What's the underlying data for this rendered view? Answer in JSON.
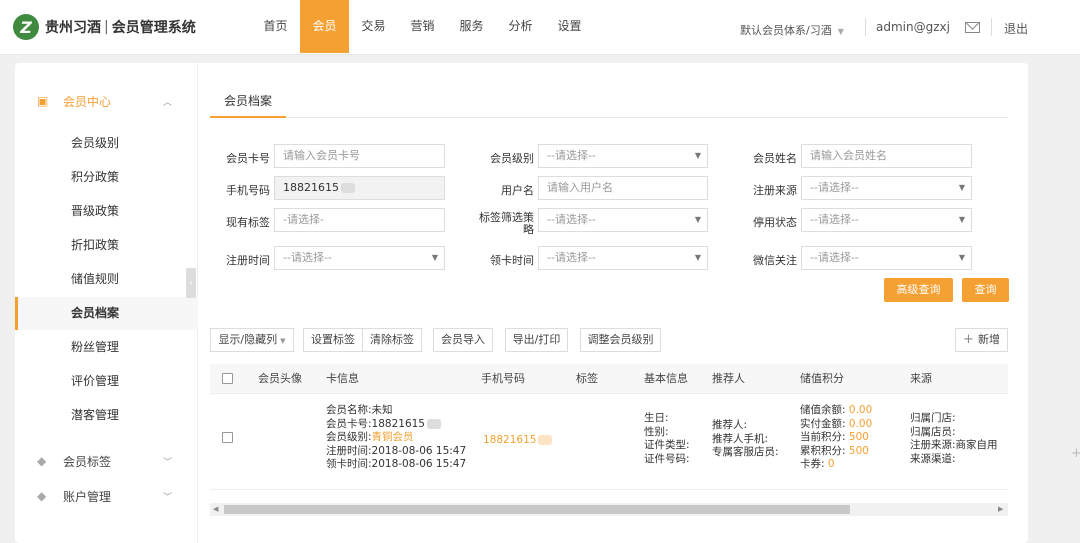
{
  "brand": {
    "logo_mark": "Z",
    "name": "贵州习酒",
    "separator": "|",
    "system": "会员管理系统"
  },
  "nav": [
    "首页",
    "会员",
    "交易",
    "营销",
    "服务",
    "分析",
    "设置"
  ],
  "system_select": "默认会员体系/习酒",
  "user": "admin@gzxj",
  "logout": "退出",
  "sidebar": {
    "group_member": "会员中心",
    "items": [
      "会员级别",
      "积分政策",
      "晋级政策",
      "折扣政策",
      "储值规则",
      "会员档案",
      "粉丝管理",
      "评价管理",
      "潜客管理"
    ],
    "group_tags": "会员标签",
    "group_accounts": "账户管理"
  },
  "tab": "会员档案",
  "filters": {
    "card_no": {
      "label": "会员卡号",
      "placeholder": "请输入会员卡号"
    },
    "level": {
      "label": "会员级别",
      "value": "--请选择--"
    },
    "name": {
      "label": "会员姓名",
      "placeholder": "请输入会员姓名"
    },
    "phone": {
      "label": "手机号码",
      "value": "18821615"
    },
    "username": {
      "label": "用户名",
      "placeholder": "请输入用户名"
    },
    "reg_source": {
      "label": "注册来源",
      "value": "--请选择--"
    },
    "current_tags": {
      "label": "现有标签",
      "value": "-请选择-"
    },
    "tag_strategy": {
      "label_line1": "标签筛选策",
      "label_line2": "略",
      "value": "--请选择--"
    },
    "disabled_status": {
      "label": "停用状态",
      "value": "--请选择--"
    },
    "reg_time": {
      "label": "注册时间",
      "value": "--请选择--"
    },
    "card_time": {
      "label": "领卡时间",
      "value": "--请选择--"
    },
    "wechat": {
      "label": "微信关注",
      "value": "--请选择--"
    }
  },
  "buttons": {
    "advanced": "高级查询",
    "query": "查询",
    "toggle_cols": "显示/隐藏列",
    "set_tag": "设置标签",
    "clear_tag": "清除标签",
    "import": "会员导入",
    "export": "导出/打印",
    "adjust_level": "调整会员级别",
    "add": "新增"
  },
  "table": {
    "headers": [
      "会员头像",
      "卡信息",
      "手机号码",
      "标签",
      "基本信息",
      "推荐人",
      "储值积分",
      "来源"
    ],
    "row": {
      "card_info": [
        "会员名称:未知",
        "会员卡号:18821615",
        "会员级别:",
        "注册时间:2018-08-06 15:47",
        "领卡时间:2018-08-06 15:47"
      ],
      "level_value": "青铜会员",
      "phone": "18821615",
      "basic": [
        "生日:",
        "性别:",
        "证件类型:",
        "证件号码:"
      ],
      "referrer": [
        "推荐人:",
        "推荐人手机:",
        "专属客服店员:"
      ],
      "balance_labels": [
        "储值余额:",
        "实付金额:",
        "当前积分:",
        "累积积分:",
        "卡券:"
      ],
      "balance_values": [
        "0.00",
        "0.00",
        "500",
        "500",
        "0"
      ],
      "source": [
        "归属门店:",
        "归属店员:",
        "注册来源:商家自用",
        "来源渠道:"
      ]
    }
  }
}
